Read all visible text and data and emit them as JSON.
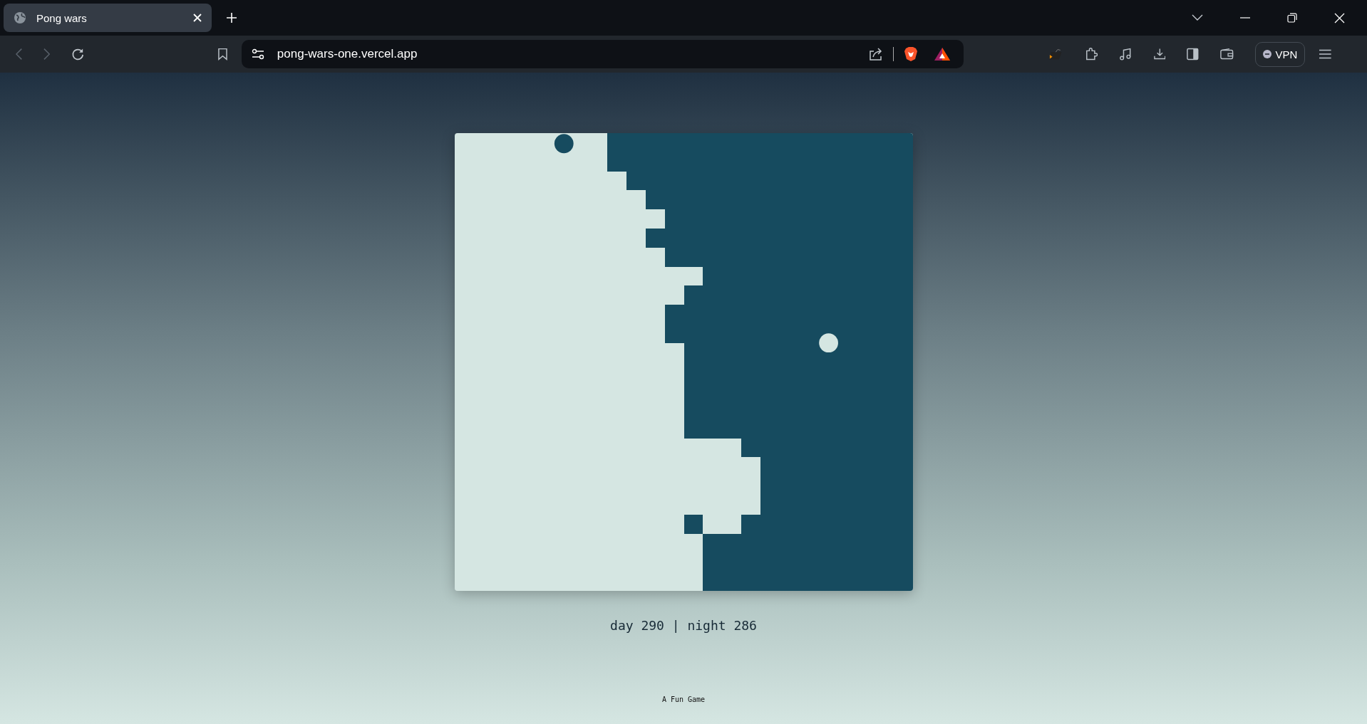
{
  "browser": {
    "tab": {
      "title": "Pong wars",
      "selected": true
    },
    "address": "pong-wars-one.vercel.app",
    "vpn_label": "VPN"
  },
  "score": "day 290 | night 286",
  "footer": "A Fun Game"
}
